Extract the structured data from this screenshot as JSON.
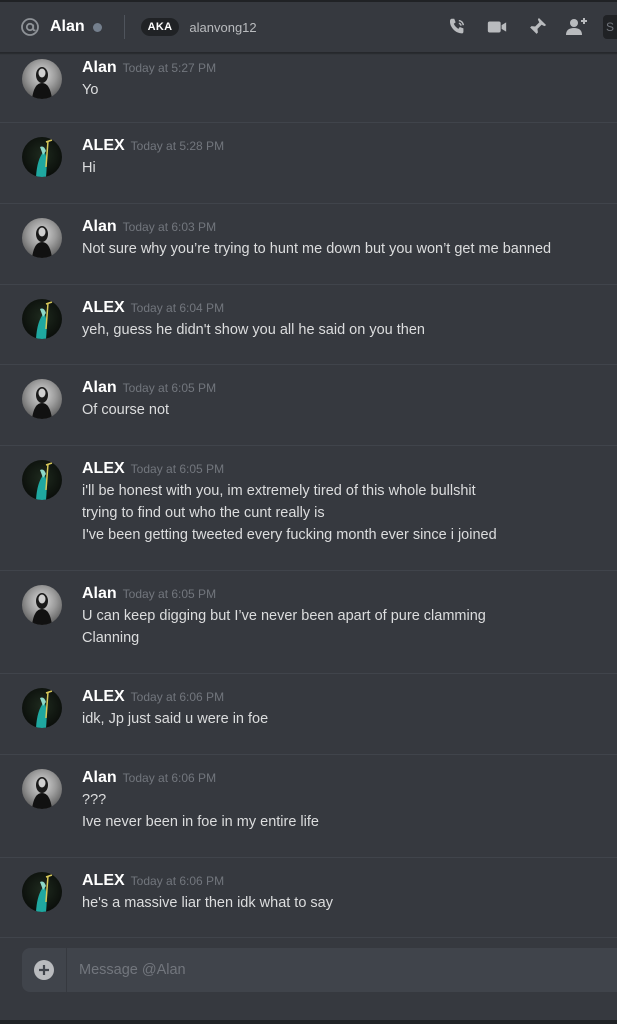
{
  "header": {
    "username": "Alan",
    "aka_badge": "AKA",
    "aka_name": "alanvong12",
    "search_stub": "S",
    "icons": [
      "at-icon",
      "call-icon",
      "video-icon",
      "pin-icon",
      "add-friend-icon"
    ],
    "status_color": "#747f8d"
  },
  "messages": [
    {
      "author": "Alan",
      "avatar": "alan",
      "timestamp": "Today at 5:27 PM",
      "lines": [
        "Yo"
      ]
    },
    {
      "author": "ALEX",
      "avatar": "alex",
      "timestamp": "Today at 5:28 PM",
      "lines": [
        "Hi"
      ]
    },
    {
      "author": "Alan",
      "avatar": "alan",
      "timestamp": "Today at 6:03 PM",
      "lines": [
        "Not sure why you’re trying to hunt me down but you won’t get me banned"
      ]
    },
    {
      "author": "ALEX",
      "avatar": "alex",
      "timestamp": "Today at 6:04 PM",
      "lines": [
        "yeh, guess he didn't show you all he said on you then"
      ]
    },
    {
      "author": "Alan",
      "avatar": "alan",
      "timestamp": "Today at 6:05 PM",
      "lines": [
        "Of course not"
      ]
    },
    {
      "author": "ALEX",
      "avatar": "alex",
      "timestamp": "Today at 6:05 PM",
      "lines": [
        "i'll be honest with you, im extremely tired of this whole bullshit",
        "trying to find out who the cunt really is",
        "I've been getting tweeted every fucking month ever since i joined"
      ]
    },
    {
      "author": "Alan",
      "avatar": "alan",
      "timestamp": "Today at 6:05 PM",
      "lines": [
        "U can keep digging but I’ve never been apart of pure clamming",
        "Clanning"
      ]
    },
    {
      "author": "ALEX",
      "avatar": "alex",
      "timestamp": "Today at 6:06 PM",
      "lines": [
        "idk, Jp just said u were in foe"
      ]
    },
    {
      "author": "Alan",
      "avatar": "alan",
      "timestamp": "Today at 6:06 PM",
      "lines": [
        "???",
        "Ive never been in foe in my entire life"
      ]
    },
    {
      "author": "ALEX",
      "avatar": "alex",
      "timestamp": "Today at 6:06 PM",
      "lines": [
        "he's a massive liar then idk what to say"
      ]
    }
  ],
  "composer": {
    "placeholder": "Message @Alan"
  },
  "colors": {
    "background": "#36393f",
    "author": "#ffffff",
    "message_text": "#dcddde",
    "timestamp": "#72767d",
    "composer_bg": "#40444b"
  }
}
